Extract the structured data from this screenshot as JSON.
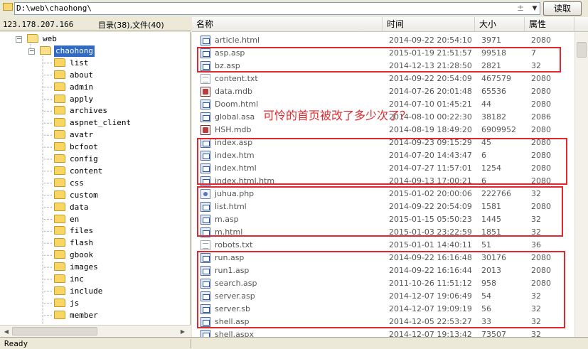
{
  "address_bar": {
    "path": "D:\\web\\chaohong\\",
    "plus_glyph": "±",
    "read_button": "读取"
  },
  "left_header": {
    "ip": "123.178.207.166",
    "counts": "目录(38),文件(40)"
  },
  "tree": {
    "root": {
      "label": "web",
      "expanded": true
    },
    "current": {
      "label": "chaohong",
      "expanded": true,
      "selected": true
    },
    "children": [
      "list",
      "about",
      "admin",
      "apply",
      "archives",
      "aspnet_client",
      "avatr",
      "bcfoot",
      "config",
      "content",
      "css",
      "custom",
      "data",
      "en",
      "files",
      "flash",
      "gbook",
      "images",
      "inc",
      "include",
      "js",
      "member"
    ]
  },
  "columns": {
    "name": "名称",
    "time": "时间",
    "size": "大小",
    "attr": "属性"
  },
  "files": [
    {
      "icon": "doc",
      "name": "article.html",
      "time": "2014-09-22 20:54:10",
      "size": "3971",
      "attr": "2080"
    },
    {
      "icon": "doc",
      "name": "asp.asp",
      "time": "2015-01-19 21:51:57",
      "size": "99518",
      "attr": "7"
    },
    {
      "icon": "doc",
      "name": "bz.asp",
      "time": "2014-12-13 21:28:50",
      "size": "2821",
      "attr": "32"
    },
    {
      "icon": "txt",
      "name": "content.txt",
      "time": "2014-09-22 20:54:09",
      "size": "467579",
      "attr": "2080"
    },
    {
      "icon": "mdb",
      "name": "data.mdb",
      "time": "2014-07-26 20:01:48",
      "size": "65536",
      "attr": "2080"
    },
    {
      "icon": "doc",
      "name": "Doom.html",
      "time": "2014-07-10 01:45:21",
      "size": "44",
      "attr": "2080"
    },
    {
      "icon": "doc",
      "name": "global.asa",
      "time": "2014-08-10 00:22:30",
      "size": "38182",
      "attr": "2086"
    },
    {
      "icon": "mdb",
      "name": "HSH.mdb",
      "time": "2014-08-19 18:49:20",
      "size": "6909952",
      "attr": "2080"
    },
    {
      "icon": "doc",
      "name": "index.asp",
      "time": "2014-09-23 09:15:29",
      "size": "45",
      "attr": "2080"
    },
    {
      "icon": "doc",
      "name": "index.htm",
      "time": "2014-07-20 14:43:47",
      "size": "6",
      "attr": "2080"
    },
    {
      "icon": "doc",
      "name": "index.html",
      "time": "2014-07-27 11:57:01",
      "size": "1254",
      "attr": "2080"
    },
    {
      "icon": "doc",
      "name": "index.html.htm",
      "time": "2014-09-13 17:00:21",
      "size": "6",
      "attr": "2080"
    },
    {
      "icon": "php",
      "name": "juhua.php",
      "time": "2015-01-02 20:00:06",
      "size": "222766",
      "attr": "32"
    },
    {
      "icon": "doc",
      "name": "list.html",
      "time": "2014-09-22 20:54:09",
      "size": "1581",
      "attr": "2080"
    },
    {
      "icon": "doc",
      "name": "m.asp",
      "time": "2015-01-15 05:50:23",
      "size": "1445",
      "attr": "32"
    },
    {
      "icon": "doc",
      "name": "m.html",
      "time": "2015-01-03 23:22:59",
      "size": "1851",
      "attr": "32"
    },
    {
      "icon": "txt",
      "name": "robots.txt",
      "time": "2015-01-01 14:40:11",
      "size": "51",
      "attr": "36"
    },
    {
      "icon": "doc",
      "name": "run.asp",
      "time": "2014-09-22 16:16:48",
      "size": "30176",
      "attr": "2080"
    },
    {
      "icon": "doc",
      "name": "run1.asp",
      "time": "2014-09-22 16:16:44",
      "size": "2013",
      "attr": "2080"
    },
    {
      "icon": "doc",
      "name": "search.asp",
      "time": "2011-10-26 11:51:12",
      "size": "958",
      "attr": "2080"
    },
    {
      "icon": "doc",
      "name": "server.asp",
      "time": "2014-12-07 19:06:49",
      "size": "54",
      "attr": "32"
    },
    {
      "icon": "doc",
      "name": "server.sb",
      "time": "2014-12-07 19:09:19",
      "size": "56",
      "attr": "32"
    },
    {
      "icon": "doc",
      "name": "shell.asp",
      "time": "2014-12-05 22:53:27",
      "size": "33",
      "attr": "32"
    },
    {
      "icon": "doc",
      "name": "shell.aspx",
      "time": "2014-12-07 19:13:42",
      "size": "73507",
      "attr": "32"
    }
  ],
  "annotation": "可怜的首页被改了多少次了？",
  "annotation_color": "#e0282e",
  "status": "Ready"
}
